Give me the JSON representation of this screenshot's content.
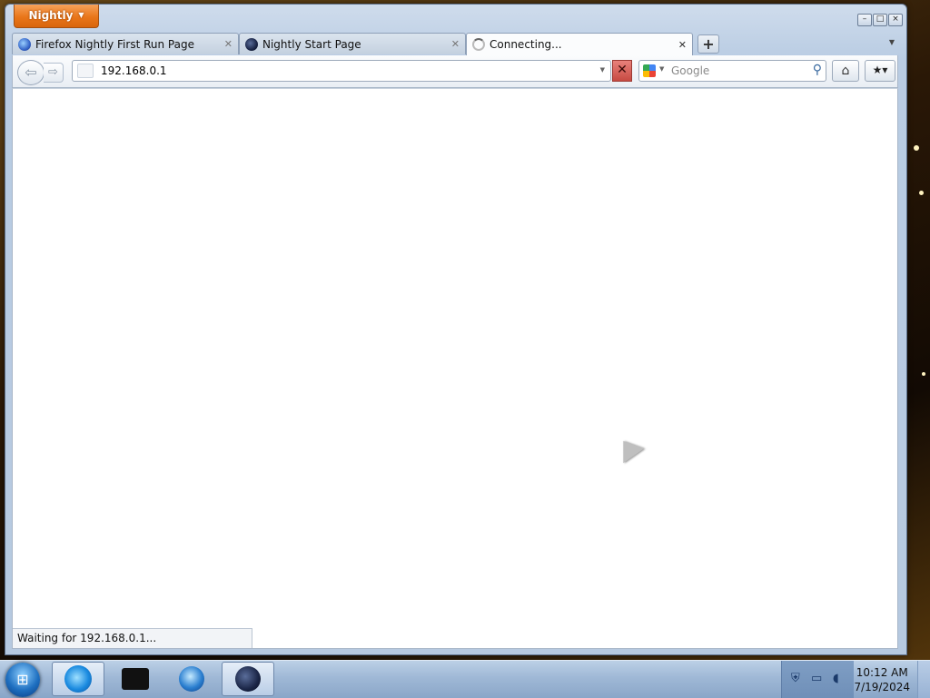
{
  "app": {
    "menu_label": "Nightly",
    "window_controls": [
      "minimize",
      "maximize",
      "close"
    ]
  },
  "tabs": [
    {
      "label": "Firefox Nightly First Run Page",
      "icon": "firefox-icon",
      "selected": false
    },
    {
      "label": "Nightly Start Page",
      "icon": "nightly-icon",
      "selected": false
    },
    {
      "label": "Connecting...",
      "icon": "loading-icon",
      "selected": true
    }
  ],
  "navbar": {
    "url": "192.168.0.1",
    "search_placeholder": "Google",
    "search_engine_icon": "google-icon"
  },
  "status": {
    "text": "Waiting for 192.168.0.1..."
  },
  "taskbar": {
    "apps": [
      "start-orb",
      "internet-explorer-icon",
      "media-center-icon",
      "windows-media-player-icon",
      "nightly-icon"
    ],
    "clock": {
      "time": "10:12 AM",
      "date": "7/19/2024"
    }
  },
  "colors": {
    "app_menu": "#e9761a",
    "stop_button": "#c74a42",
    "taskbar": "#9fb8d6"
  }
}
